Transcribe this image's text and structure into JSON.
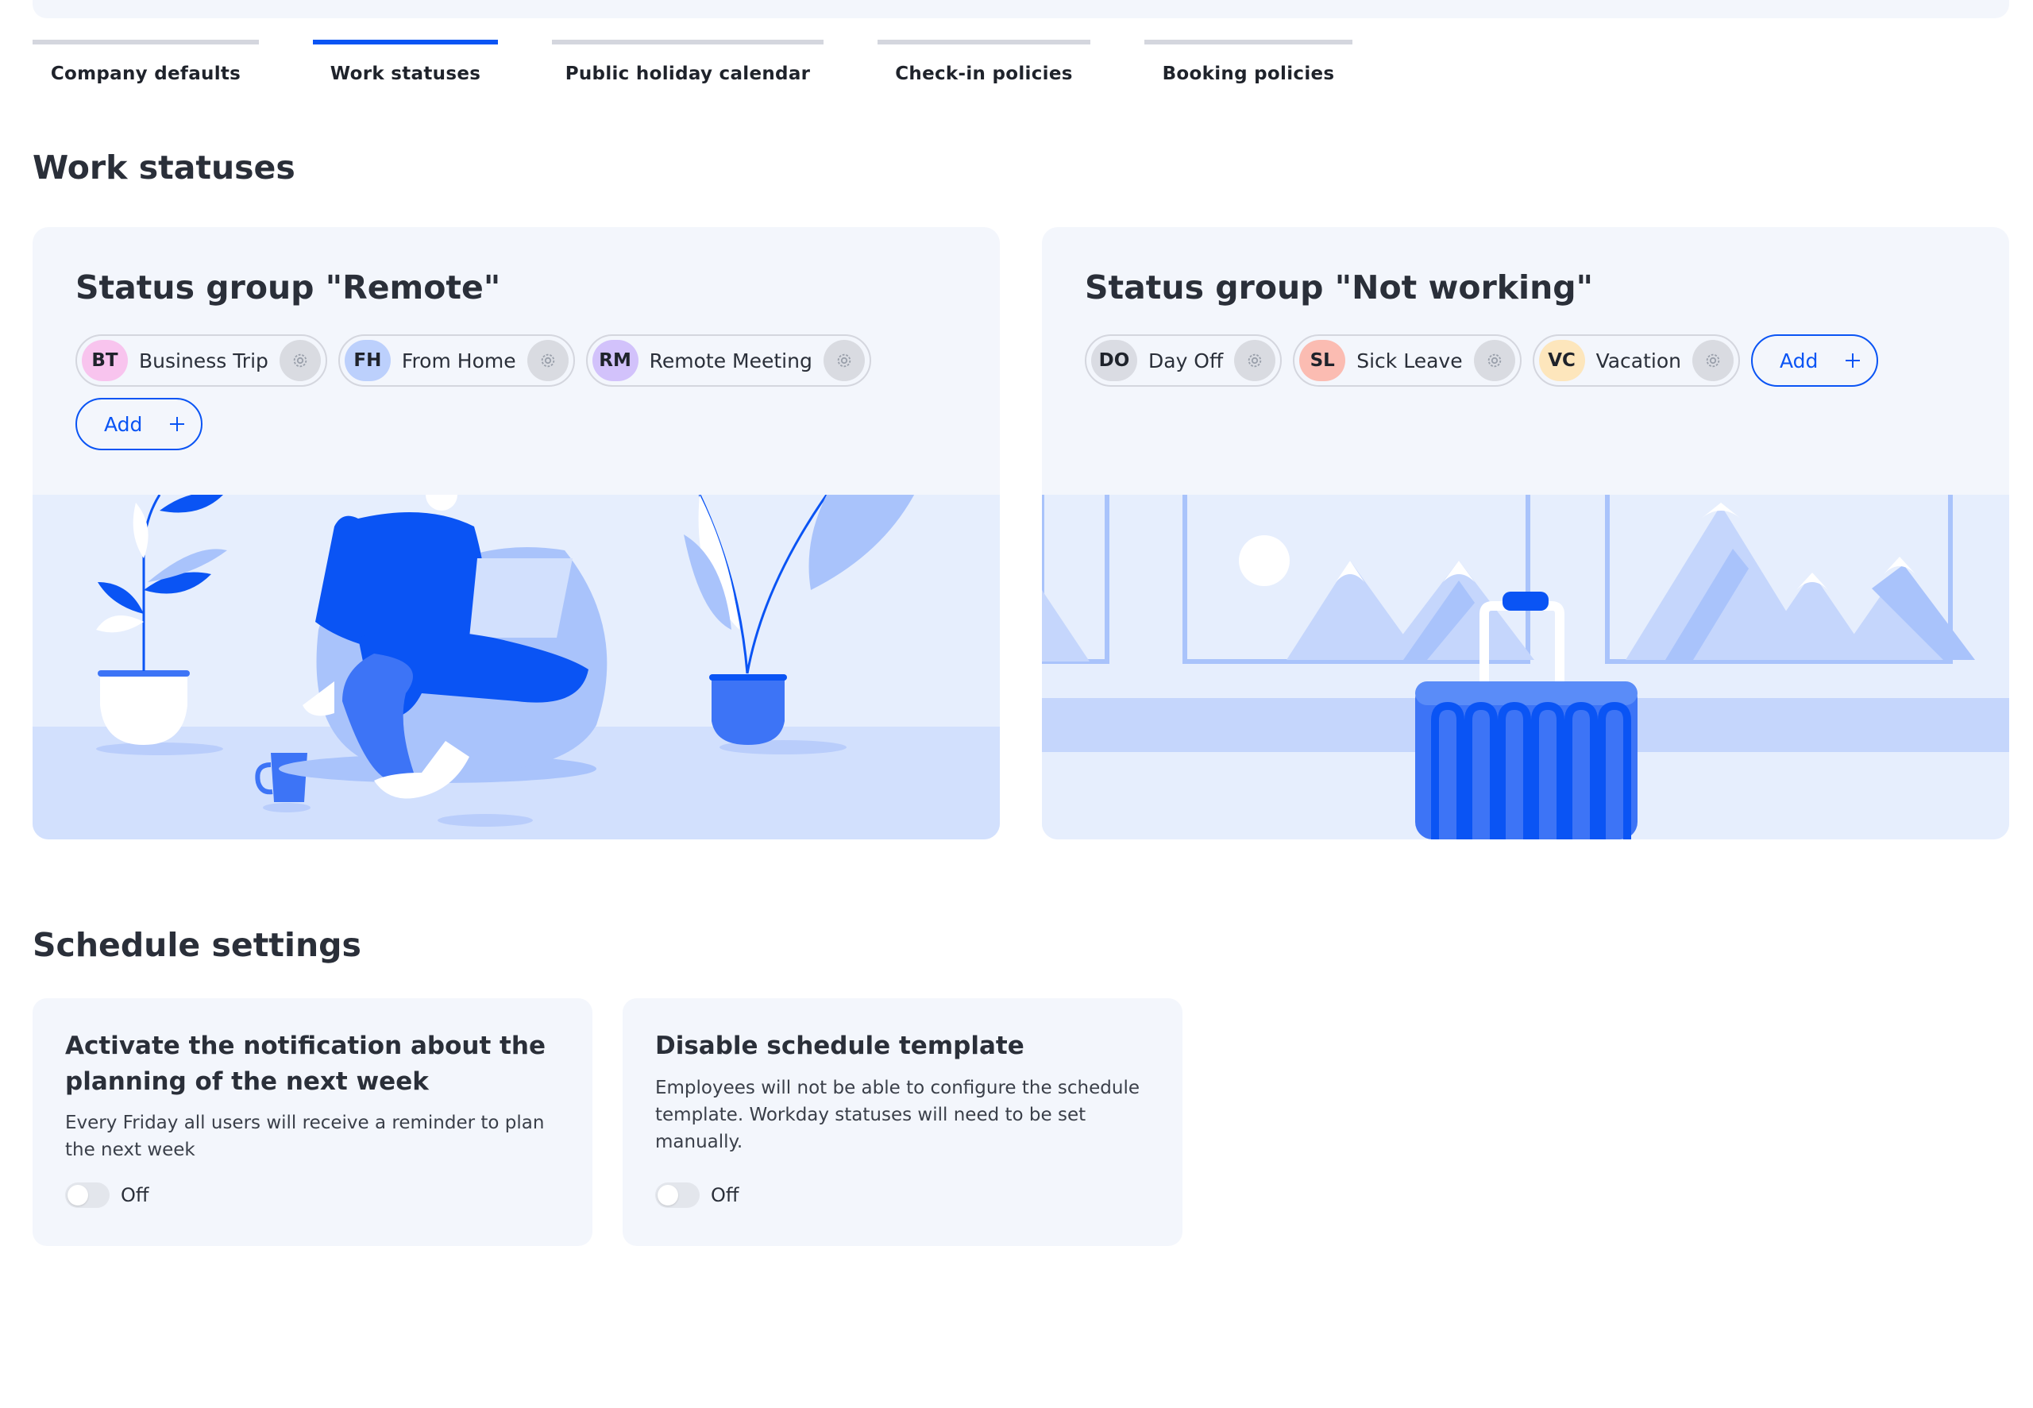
{
  "tabs": [
    {
      "label": "Company defaults"
    },
    {
      "label": "Work statuses"
    },
    {
      "label": "Public holiday calendar"
    },
    {
      "label": "Check-in policies"
    },
    {
      "label": "Booking policies"
    }
  ],
  "active_tab": "Work statuses",
  "work_statuses": {
    "title": "Work statuses",
    "groups": [
      {
        "title": "Status group \"Remote\"",
        "statuses": [
          {
            "code": "BT",
            "label": "Business Trip",
            "color": "#f8c4ee"
          },
          {
            "code": "FH",
            "label": "From Home",
            "color": "#bcd0fc"
          },
          {
            "code": "RM",
            "label": "Remote Meeting",
            "color": "#d2c2fb"
          }
        ],
        "add_label": "Add"
      },
      {
        "title": "Status group \"Not working\"",
        "statuses": [
          {
            "code": "DO",
            "label": "Day Off",
            "color": "#dadce3"
          },
          {
            "code": "SL",
            "label": "Sick Leave",
            "color": "#fbbcb2"
          },
          {
            "code": "VC",
            "label": "Vacation",
            "color": "#fde6bc"
          }
        ],
        "add_label": "Add"
      }
    ]
  },
  "schedule_settings": {
    "title": "Schedule settings",
    "cards": [
      {
        "title": "Activate the notification about the planning of the next week",
        "description": "Every Friday all users will receive a reminder to plan the next week",
        "toggle_label": "Off",
        "enabled": false
      },
      {
        "title": "Disable schedule template",
        "description": "Employees will not be able to configure the schedule template. Workday statuses will need to be set manually.",
        "toggle_label": "Off",
        "enabled": false
      }
    ]
  },
  "colors": {
    "accent": "#0a54f4",
    "card_bg": "#f3f6fc",
    "illustration_light": "#dbe6fd",
    "illustration_mid": "#a9c3fb",
    "illustration_dark": "#0a54f4"
  }
}
